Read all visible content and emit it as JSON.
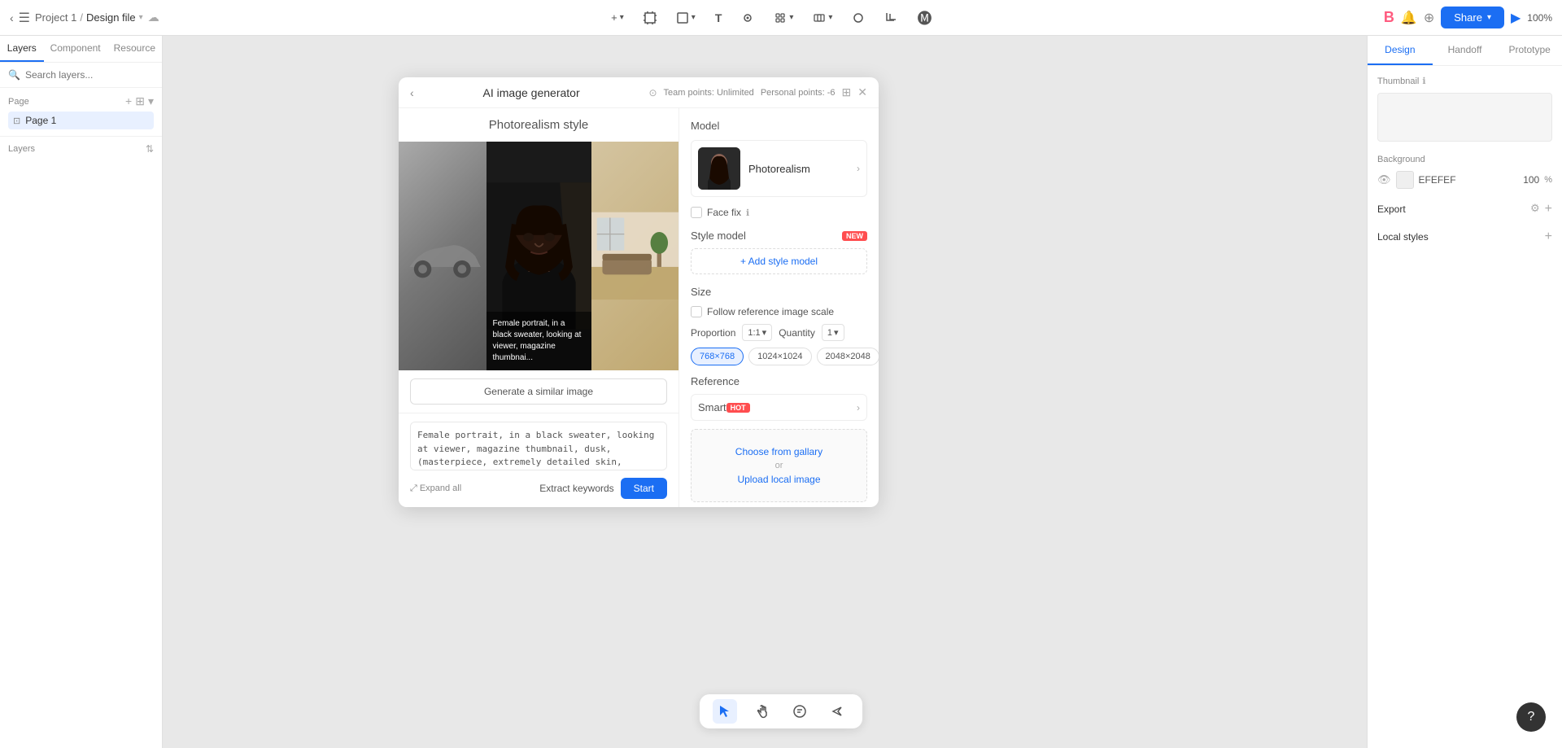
{
  "app": {
    "title": "Project Design file"
  },
  "topbar": {
    "project": "Project 1",
    "separator": "/",
    "filename": "Design file",
    "share_label": "Share",
    "zoom": "100%"
  },
  "left_sidebar": {
    "tabs": [
      "Layers",
      "Component",
      "Resource"
    ],
    "active_tab": "Layers",
    "search_placeholder": "Search layers...",
    "page_section": "Page",
    "page_name": "Page 1",
    "layers_section": "Layers"
  },
  "right_sidebar": {
    "tabs": [
      "Design",
      "Handoff",
      "Prototype"
    ],
    "active_tab": "Design",
    "thumbnail_label": "Thumbnail",
    "background_label": "Background",
    "bg_color": "EFEFEF",
    "bg_opacity": "100",
    "export_label": "Export",
    "local_styles_label": "Local styles"
  },
  "ai_panel": {
    "title": "AI image generator",
    "team_points": "Team points: Unlimited",
    "personal_points": "Personal points: -6",
    "style_title": "Photorealism style",
    "generate_btn": "Generate a similar image",
    "prompt_text": "Female portrait, in a black sweater, looking at viewer, magazine thumbnail, dusk, (masterpiece, extremely detailed skin, photorealistic, heavy shadow, dramatic and cinematic lighting,",
    "expand_label": "Expand all",
    "extract_keywords": "Extract keywords",
    "start_btn": "Start",
    "img_overlay": "Female portrait, in a black sweater, looking at viewer, magazine thumbnai...",
    "model_section": "Model",
    "model_name": "Photorealism",
    "face_fix_label": "Face fix",
    "style_model_label": "Style model",
    "new_badge": "NEW",
    "add_style_label": "+ Add style model",
    "size_label": "Size",
    "follow_ref_label": "Follow reference image scale",
    "proportion_label": "Proportion",
    "proportion_value": "1:1",
    "quantity_label": "Quantity",
    "quantity_value": "1",
    "size_options": [
      "768×768",
      "1024×1024",
      "2048×2048"
    ],
    "active_size": "768×768",
    "reference_label": "Reference",
    "smart_label": "Smart",
    "hot_badge": "HOT",
    "choose_gallery": "Choose from gallary",
    "upload_or": "or",
    "upload_local": "Upload local image"
  },
  "bottom_toolbar": {
    "tools": [
      "cursor",
      "hand",
      "comment",
      "more"
    ]
  },
  "help": "?"
}
